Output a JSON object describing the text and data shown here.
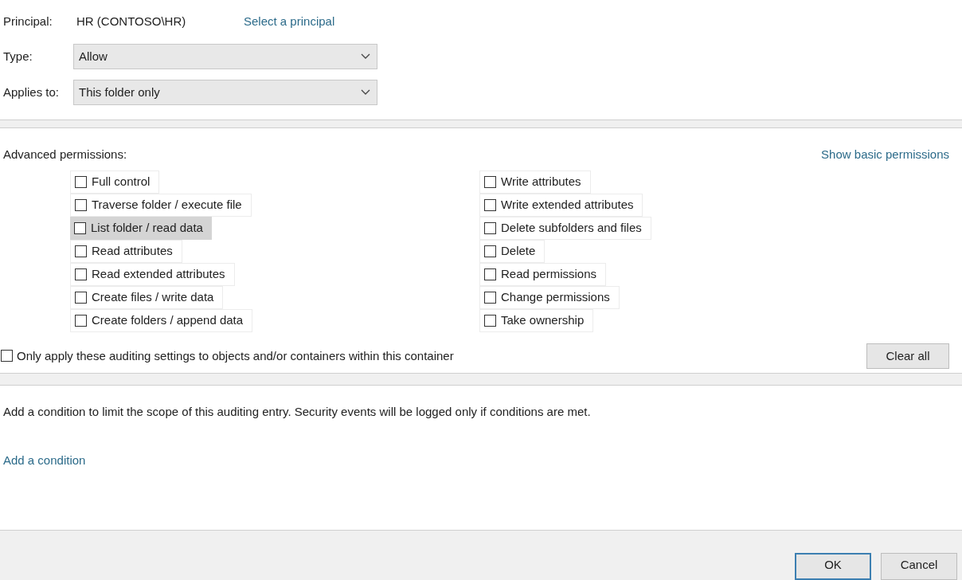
{
  "principal": {
    "label": "Principal:",
    "value": "HR (CONTOSO\\HR)",
    "link": "Select a principal"
  },
  "type": {
    "label": "Type:",
    "value": "Allow"
  },
  "applies_to": {
    "label": "Applies to:",
    "value": "This folder only"
  },
  "advanced_permissions": {
    "title": "Advanced permissions:",
    "link": "Show basic permissions",
    "columns": [
      [
        {
          "label": "Full control",
          "checked": false,
          "highlighted": false
        },
        {
          "label": "Traverse folder / execute file",
          "checked": false,
          "highlighted": false
        },
        {
          "label": "List folder / read data",
          "checked": false,
          "highlighted": true
        },
        {
          "label": "Read attributes",
          "checked": false,
          "highlighted": false
        },
        {
          "label": "Read extended attributes",
          "checked": false,
          "highlighted": false
        },
        {
          "label": "Create files / write data",
          "checked": false,
          "highlighted": false
        },
        {
          "label": "Create folders / append data",
          "checked": false,
          "highlighted": false
        }
      ],
      [
        {
          "label": "Write attributes",
          "checked": false,
          "highlighted": false
        },
        {
          "label": "Write extended attributes",
          "checked": false,
          "highlighted": false
        },
        {
          "label": "Delete subfolders and files",
          "checked": false,
          "highlighted": false
        },
        {
          "label": "Delete",
          "checked": false,
          "highlighted": false
        },
        {
          "label": "Read permissions",
          "checked": false,
          "highlighted": false
        },
        {
          "label": "Change permissions",
          "checked": false,
          "highlighted": false
        },
        {
          "label": "Take ownership",
          "checked": false,
          "highlighted": false
        }
      ]
    ],
    "only_apply": {
      "label": "Only apply these auditing settings to objects and/or containers within this container",
      "checked": false
    },
    "clear_button": "Clear all"
  },
  "condition": {
    "text": "Add a condition to limit the scope of this auditing entry. Security events will be logged only if conditions are met.",
    "link": "Add a condition"
  },
  "buttons": [
    {
      "label": "OK",
      "default": true
    },
    {
      "label": "Cancel",
      "default": false
    }
  ]
}
